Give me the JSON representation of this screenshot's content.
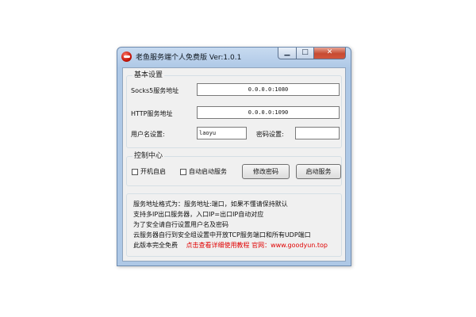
{
  "window": {
    "title": "老鱼服务端个人免费版 Ver:1.0.1",
    "min_glyph": "▁",
    "max_glyph": "□",
    "close_glyph": "✕"
  },
  "basic": {
    "group_title": "基本设置",
    "socks5_label": "Socks5服务地址",
    "socks5_value": "0.0.0.0:1080",
    "http_label": "HTTP服务地址",
    "http_value": "0.0.0.0:1090",
    "username_label": "用户名设置:",
    "username_value": "laoyu",
    "password_label": "密码设置:",
    "password_value": ""
  },
  "control": {
    "group_title": "控制中心",
    "autostart_label": "开机自启",
    "autostart_checked": false,
    "autoservice_label": "自动启动服务",
    "autoservice_checked": false,
    "change_password_button": "修改密码",
    "start_service_button": "启动服务"
  },
  "info": {
    "line1": "服务地址格式为：服务地址:端口，如果不懂请保持默认",
    "line2": "支持多IP出口服务器，入口IP=出口IP自动对应",
    "line3": "为了安全请自行设置用户名及密码",
    "line4": "云服务器自行到安全组设置中开放TCP服务端口和所有UDP端口",
    "line5_prefix": "此版本完全免费",
    "line5_link": "点击查看详细使用教程 官网：www.goodyun.top"
  },
  "colors": {
    "link_red": "#e00000",
    "title_bar": "#aec8e6"
  }
}
